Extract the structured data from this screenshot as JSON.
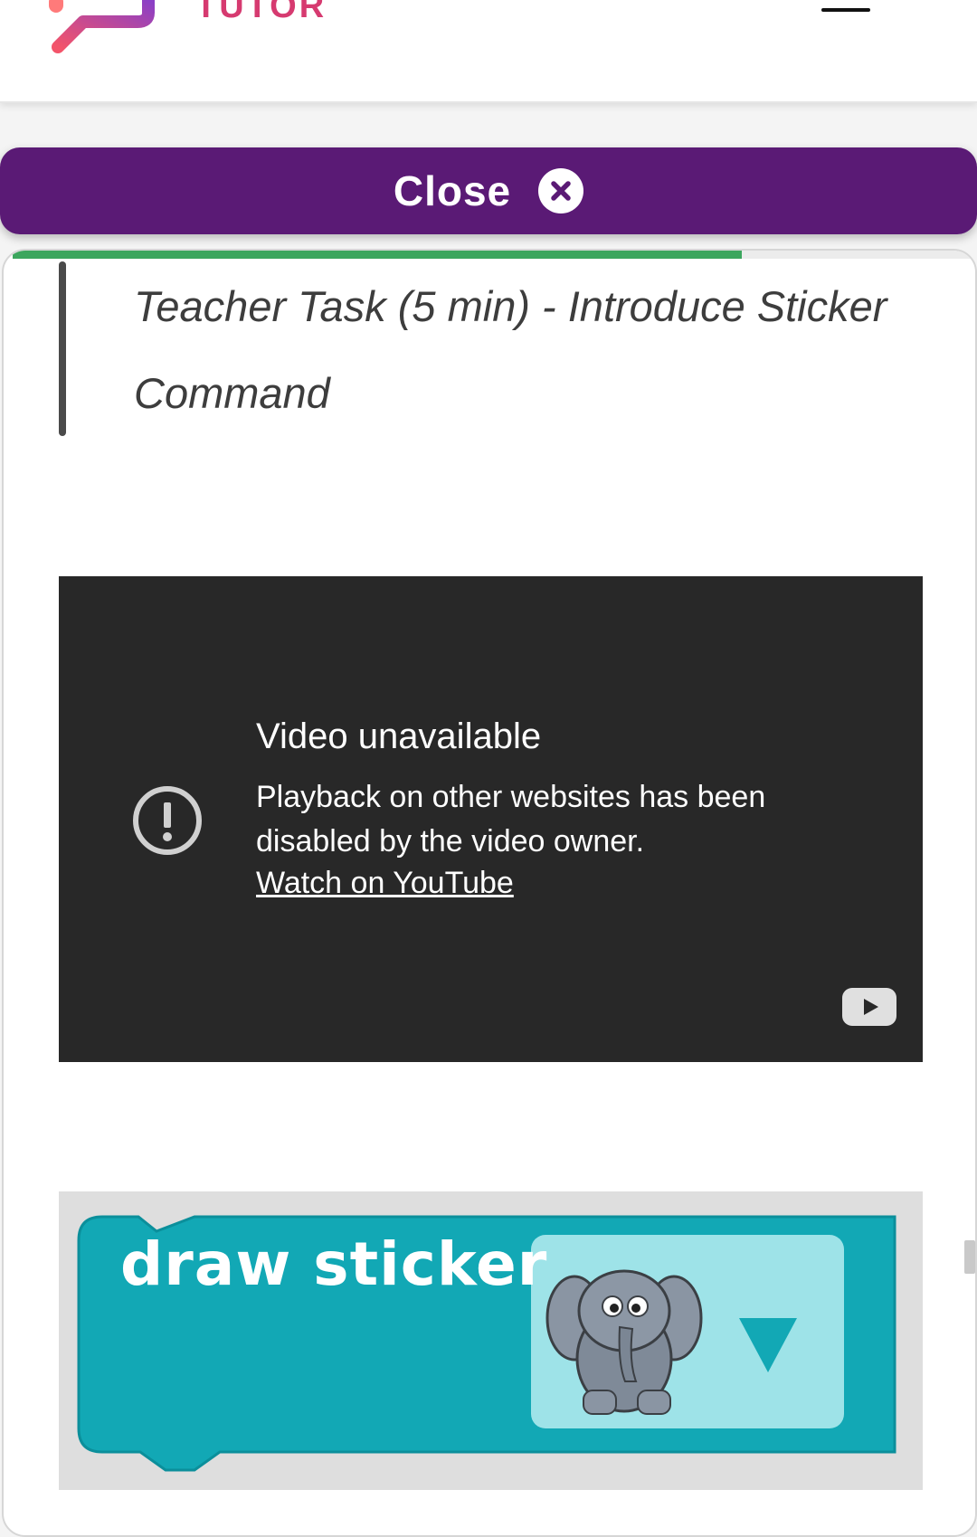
{
  "header": {
    "logo_text": "TUTOR",
    "menu_icon": "hamburger-menu-icon"
  },
  "close_bar": {
    "label": "Close",
    "icon": "close-circle-icon",
    "color": "#5a1a75"
  },
  "lesson": {
    "progress_percent": 76,
    "progress_color": "#3ca65e",
    "heading": "Teacher Task (5 min) - Introduce Sticker Command"
  },
  "video": {
    "title": "Video unavailable",
    "message": "Playback on other websites has been disabled by the video owner.",
    "link_label": "Watch on YouTube",
    "alert_icon": "exclamation-circle-icon",
    "logo_icon": "youtube-play-icon"
  },
  "code_block": {
    "label": "draw sticker",
    "sticker_icon": "elephant-icon",
    "dropdown_icon": "triangle-down-icon",
    "color": "#12a8b5"
  }
}
